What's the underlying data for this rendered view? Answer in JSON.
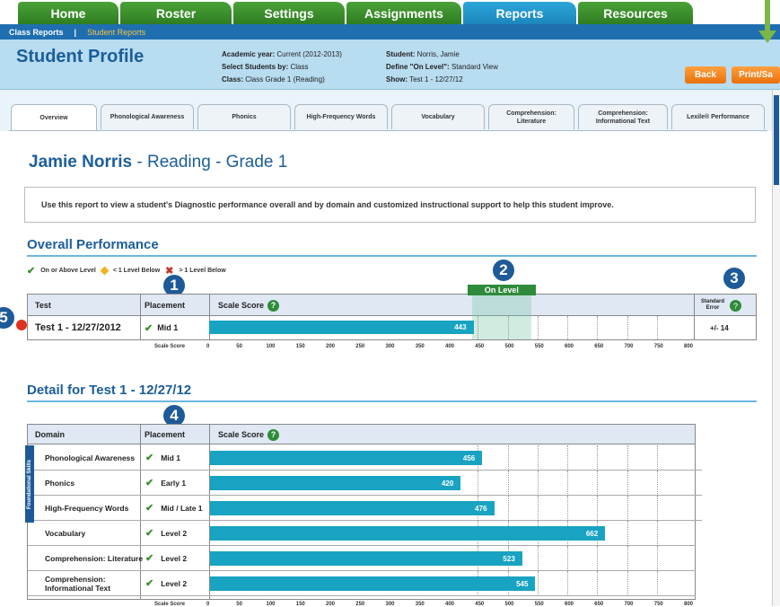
{
  "nav": {
    "tabs": [
      "Home",
      "Roster",
      "Settings",
      "Assignments",
      "Reports",
      "Resources"
    ],
    "active": "Reports",
    "breadcrumb": [
      "Class Reports",
      "Student Reports"
    ]
  },
  "header": {
    "title": "Student Profile",
    "academic_year_label": "Academic year:",
    "academic_year": "Current (2012-2013)",
    "select_by_label": "Select Students by:",
    "select_by": "Class",
    "class_label": "Class:",
    "class": "Class Grade 1 (Reading)",
    "student_label": "Student:",
    "student": "Norris, Jamie",
    "define_label": "Define \"On Level\":",
    "define": "Standard View",
    "show_label": "Show:",
    "show": "Test 1 - 12/27/12",
    "back_button": "Back",
    "print_button": "Print/Sa"
  },
  "subtabs": [
    "Overview",
    "Phonological Awareness",
    "Phonics",
    "High-Frequency Words",
    "Vocabulary",
    "Comprehension: Literature",
    "Comprehension: Informational Text",
    "Lexile® Performance"
  ],
  "main": {
    "name": "Jamie Norris",
    "subtitle": " - Reading - Grade 1",
    "note": "Use this report to view a student's Diagnostic performance overall and by domain and customized instructional support to help this student improve."
  },
  "overall": {
    "title": "Overall Performance",
    "legend": [
      "On or Above Level",
      "< 1 Level Below",
      "> 1 Level Below"
    ],
    "col_test": "Test",
    "col_placement": "Placement",
    "col_scale": "Scale Score",
    "col_error": "Standard Error",
    "on_level": "On Level",
    "test_name": "Test 1 - 12/27/2012",
    "placement": "Mid 1",
    "score": 443,
    "error": "+/- 14",
    "axis_label": "Scale Score",
    "badge1": "1",
    "badge2": "2",
    "badge3": "3",
    "badge5": "5"
  },
  "detail": {
    "title": "Detail for Test 1 - 12/27/12",
    "col_domain": "Domain",
    "col_placement": "Placement",
    "col_scale": "Scale Score",
    "badge4": "4",
    "foundational": "Foundational Skills",
    "axis_label": "Scale Score",
    "rows": [
      {
        "domain": "Phonological Awareness",
        "placement": "Mid 1",
        "score": 456
      },
      {
        "domain": "Phonics",
        "placement": "Early 1",
        "score": 420
      },
      {
        "domain": "High-Frequency Words",
        "placement": "Mid / Late 1",
        "score": 476
      },
      {
        "domain": "Vocabulary",
        "placement": "Level 2",
        "score": 662
      },
      {
        "domain": "Comprehension: Literature",
        "placement": "Level 2",
        "score": 523
      },
      {
        "domain": "Comprehension: Informational Text",
        "placement": "Level 2",
        "score": 545
      }
    ]
  },
  "axis_ticks": [
    "0",
    "50",
    "100",
    "150",
    "200",
    "250",
    "300",
    "350",
    "400",
    "450",
    "500",
    "550",
    "600",
    "650",
    "700",
    "750",
    "800"
  ],
  "colors": {
    "nav_green": "#2e7d22",
    "nav_blue": "#1b86bd",
    "bar": "#18a3c2",
    "accent": "#1b5e9a",
    "orange": "#e8700a"
  }
}
